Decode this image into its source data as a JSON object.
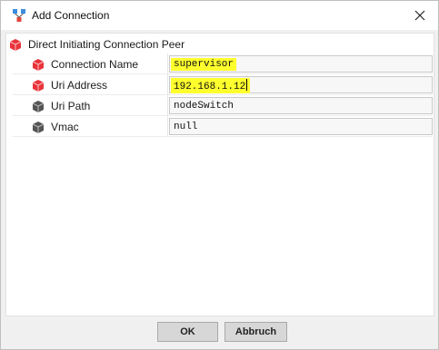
{
  "window": {
    "title": "Add Connection",
    "title_icon": "network-connection-icon",
    "close_icon": "close-icon"
  },
  "group": {
    "label": "Direct Initiating Connection Peer",
    "icon": "red-cube-icon"
  },
  "properties": [
    {
      "name": "Connection Name",
      "value": "supervisor",
      "icon": "red-cube-icon",
      "highlighted": true
    },
    {
      "name": "Uri Address",
      "value": "192.168.1.12",
      "icon": "red-cube-icon",
      "highlighted": true
    },
    {
      "name": "Uri Path",
      "value": "nodeSwitch",
      "icon": "gray-cube-icon",
      "highlighted": false
    },
    {
      "name": "Vmac",
      "value": "null",
      "icon": "gray-cube-icon",
      "highlighted": false
    }
  ],
  "buttons": {
    "ok_label": "OK",
    "cancel_label": "Abbruch"
  },
  "colors": {
    "highlight": "#ffff2e",
    "red_cube": "#e8343a",
    "gray_cube": "#555555"
  }
}
